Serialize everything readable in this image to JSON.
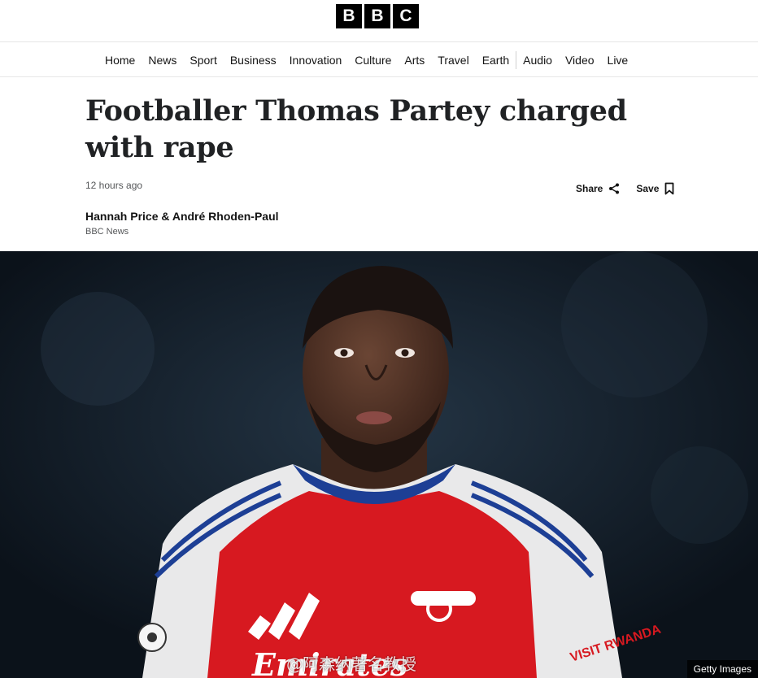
{
  "logo": {
    "letters": [
      "B",
      "B",
      "C"
    ]
  },
  "nav": {
    "items": [
      "Home",
      "News",
      "Sport",
      "Business",
      "Innovation",
      "Culture",
      "Arts",
      "Travel",
      "Earth",
      "Audio",
      "Video",
      "Live"
    ]
  },
  "article": {
    "headline": "Footballer Thomas Partey charged with rape",
    "timestamp": "12 hours ago",
    "share_label": "Share",
    "save_label": "Save",
    "byline": {
      "authors": "Hannah Price & André Rhoden-Paul",
      "organisation": "BBC News"
    }
  },
  "hero_image": {
    "credit": "Getty Images",
    "watermark": "@阿森纳著名教授",
    "sponsor_text": "Emirates",
    "sleeve_text": "VISIT RWANDA"
  },
  "colors": {
    "logo_bg": "#000000",
    "jersey_red": "#d71920",
    "jersey_white": "#f2f2f2",
    "jersey_blue": "#1d3f95"
  }
}
